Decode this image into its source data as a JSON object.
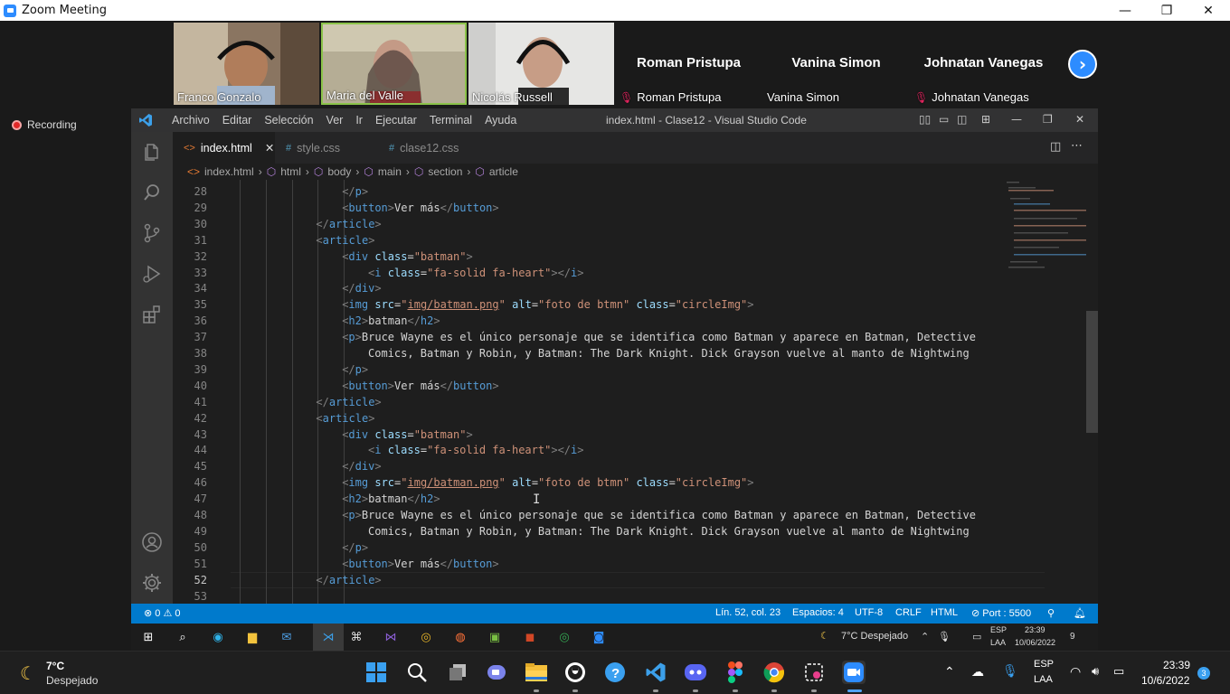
{
  "zoom": {
    "title": "Zoom Meeting",
    "window_controls": [
      "—",
      "❐",
      "✕"
    ],
    "participants": [
      {
        "name": "Franco Gonzalo",
        "has_video": true
      },
      {
        "name": "Maria del Valle",
        "has_video": true
      },
      {
        "name": "Nicolás Russell",
        "has_video": true
      },
      {
        "name": "Roman Pristupa",
        "label": "Roman Pristupa",
        "muted": true,
        "has_video": false
      },
      {
        "name": "Vanina Simon",
        "label": "Vanina Simon",
        "muted": false,
        "has_video": false
      },
      {
        "name": "Johnatan Vanegas",
        "label": "Johnatan Vanegas",
        "muted": true,
        "has_video": false
      }
    ],
    "recording_label": "Recording"
  },
  "vscode": {
    "menu": [
      "Archivo",
      "Editar",
      "Selección",
      "Ver",
      "Ir",
      "Ejecutar",
      "Terminal",
      "Ayuda"
    ],
    "window_title": "index.html - Clase12 - Visual Studio Code",
    "tabs": [
      {
        "label": "index.html",
        "icon": "<>",
        "active": true
      },
      {
        "label": "style.css",
        "icon": "#",
        "active": false
      },
      {
        "label": "clase12.css",
        "icon": "#",
        "active": false
      }
    ],
    "breadcrumb": [
      "index.html",
      "html",
      "body",
      "main",
      "section",
      "article"
    ],
    "current_line": 52,
    "lines": [
      {
        "n": 28,
        "indent": 4,
        "html": "<span class='g'>&lt;/</span><span class='t'>p</span><span class='g'>&gt;</span>"
      },
      {
        "n": 29,
        "indent": 4,
        "html": "<span class='g'>&lt;</span><span class='t'>button</span><span class='g'>&gt;</span>Ver más<span class='g'>&lt;/</span><span class='t'>button</span><span class='g'>&gt;</span>"
      },
      {
        "n": 30,
        "indent": 3,
        "html": "<span class='g'>&lt;/</span><span class='t'>article</span><span class='g'>&gt;</span>"
      },
      {
        "n": 31,
        "indent": 3,
        "html": "<span class='g'>&lt;</span><span class='t'>article</span><span class='g'>&gt;</span>"
      },
      {
        "n": 32,
        "indent": 4,
        "html": "<span class='g'>&lt;</span><span class='t'>div</span> <span class='a'>class</span>=<span class='s'>\"batman\"</span><span class='g'>&gt;</span>"
      },
      {
        "n": 33,
        "indent": 5,
        "html": "<span class='g'>&lt;</span><span class='t'>i</span> <span class='a'>class</span>=<span class='s'>\"fa-solid fa-heart\"</span><span class='g'>&gt;&lt;/</span><span class='t'>i</span><span class='g'>&gt;</span>"
      },
      {
        "n": 34,
        "indent": 4,
        "html": "<span class='g'>&lt;/</span><span class='t'>div</span><span class='g'>&gt;</span>"
      },
      {
        "n": 35,
        "indent": 4,
        "html": "<span class='g'>&lt;</span><span class='t'>img</span> <span class='a'>src</span>=<span class='s'>\"</span><span class='u'>img/batman.png</span><span class='s'>\"</span> <span class='a'>alt</span>=<span class='s'>\"foto de btmn\"</span> <span class='a'>class</span>=<span class='s'>\"circleImg\"</span><span class='g'>&gt;</span>"
      },
      {
        "n": 36,
        "indent": 4,
        "html": "<span class='g'>&lt;</span><span class='t'>h2</span><span class='g'>&gt;</span>batman<span class='g'>&lt;/</span><span class='t'>h2</span><span class='g'>&gt;</span>"
      },
      {
        "n": 37,
        "indent": 4,
        "html": "<span class='g'>&lt;</span><span class='t'>p</span><span class='g'>&gt;</span>Bruce Wayne es el único personaje que se identifica como Batman y aparece en Batman, Detective"
      },
      {
        "n": 38,
        "indent": 5,
        "html": "Comics, Batman y Robin, y Batman: The Dark Knight. Dick Grayson vuelve al manto de Nightwing"
      },
      {
        "n": 39,
        "indent": 4,
        "html": "<span class='g'>&lt;/</span><span class='t'>p</span><span class='g'>&gt;</span>"
      },
      {
        "n": 40,
        "indent": 4,
        "html": "<span class='g'>&lt;</span><span class='t'>button</span><span class='g'>&gt;</span>Ver más<span class='g'>&lt;/</span><span class='t'>button</span><span class='g'>&gt;</span>"
      },
      {
        "n": 41,
        "indent": 3,
        "html": "<span class='g'>&lt;/</span><span class='t'>article</span><span class='g'>&gt;</span>"
      },
      {
        "n": 42,
        "indent": 3,
        "html": "<span class='g'>&lt;</span><span class='t'>article</span><span class='g'>&gt;</span>"
      },
      {
        "n": 43,
        "indent": 4,
        "html": "<span class='g'>&lt;</span><span class='t'>div</span> <span class='a'>class</span>=<span class='s'>\"batman\"</span><span class='g'>&gt;</span>"
      },
      {
        "n": 44,
        "indent": 5,
        "html": "<span class='g'>&lt;</span><span class='t'>i</span> <span class='a'>class</span>=<span class='s'>\"fa-solid fa-heart\"</span><span class='g'>&gt;&lt;/</span><span class='t'>i</span><span class='g'>&gt;</span>"
      },
      {
        "n": 45,
        "indent": 4,
        "html": "<span class='g'>&lt;/</span><span class='t'>div</span><span class='g'>&gt;</span>"
      },
      {
        "n": 46,
        "indent": 4,
        "html": "<span class='g'>&lt;</span><span class='t'>img</span> <span class='a'>src</span>=<span class='s'>\"</span><span class='u'>img/batman.png</span><span class='s'>\"</span> <span class='a'>alt</span>=<span class='s'>\"foto de btmn\"</span> <span class='a'>class</span>=<span class='s'>\"circleImg\"</span><span class='g'>&gt;</span>"
      },
      {
        "n": 47,
        "indent": 4,
        "html": "<span class='g'>&lt;</span><span class='t'>h2</span><span class='g'>&gt;</span>batman<span class='g'>&lt;/</span><span class='t'>h2</span><span class='g'>&gt;</span>"
      },
      {
        "n": 48,
        "indent": 4,
        "html": "<span class='g'>&lt;</span><span class='t'>p</span><span class='g'>&gt;</span>Bruce Wayne es el único personaje que se identifica como Batman y aparece en Batman, Detective"
      },
      {
        "n": 49,
        "indent": 5,
        "html": "Comics, Batman y Robin, y Batman: The Dark Knight. Dick Grayson vuelve al manto de Nightwing"
      },
      {
        "n": 50,
        "indent": 4,
        "html": "<span class='g'>&lt;/</span><span class='t'>p</span><span class='g'>&gt;</span>"
      },
      {
        "n": 51,
        "indent": 4,
        "html": "<span class='g'>&lt;</span><span class='t'>button</span><span class='g'>&gt;</span>Ver más<span class='g'>&lt;/</span><span class='t'>button</span><span class='g'>&gt;</span>"
      },
      {
        "n": 52,
        "indent": 3,
        "html": "<span class='g'>&lt;/</span><span class='t'>article</span><span class='g'>&gt;</span>"
      },
      {
        "n": 53,
        "indent": 0,
        "html": ""
      }
    ],
    "status": {
      "problems": "⊗ 0 ⚠ 0",
      "position": "Lín. 52, col. 23",
      "spaces": "Espacios: 4",
      "encoding": "UTF-8",
      "eol": "CRLF",
      "language": "HTML",
      "port": "⊘ Port : 5500"
    }
  },
  "inner_taskbar": {
    "weather": "7°C  Despejado",
    "lang": "ESP",
    "lang2": "LAA",
    "time": "23:39",
    "date": "10/06/2022",
    "notifications": "9"
  },
  "taskbar": {
    "weather_temp": "7°C",
    "weather_desc": "Despejado",
    "lang": "ESP",
    "lang2": "LAA",
    "time": "23:39",
    "date": "10/6/2022",
    "notifications": "3"
  },
  "colors": {
    "zoom_blue": "#2d8cff",
    "vscode_status": "#007acc",
    "tag": "#569cd6",
    "attr": "#9cdcfe",
    "string": "#ce9178"
  }
}
